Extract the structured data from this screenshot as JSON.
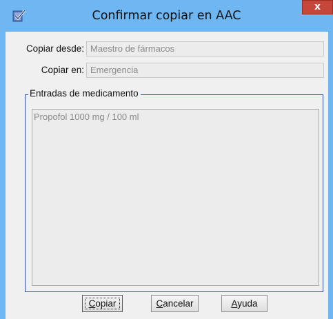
{
  "window": {
    "title": "Confirmar copiar en AAC",
    "close_glyph": "x",
    "app_icon": "checklist-icon",
    "colors": {
      "frame": "#6fb7f2",
      "close": "#c7463b",
      "group_border": "#2f4fa0"
    }
  },
  "form": {
    "copy_from": {
      "label": "Copiar desde:",
      "value": "Maestro de fármacos"
    },
    "copy_to": {
      "label": "Copiar en:",
      "value": "Emergencia"
    }
  },
  "entries": {
    "legend": "Entradas de medicamento",
    "items": [
      "Propofol 1000 mg / 100 ml"
    ]
  },
  "buttons": {
    "copy": {
      "mnemonic": "C",
      "rest": "opiar"
    },
    "cancel": {
      "mnemonic": "C",
      "rest": "ancelar"
    },
    "help": {
      "mnemonic": "A",
      "rest": "yuda"
    }
  }
}
